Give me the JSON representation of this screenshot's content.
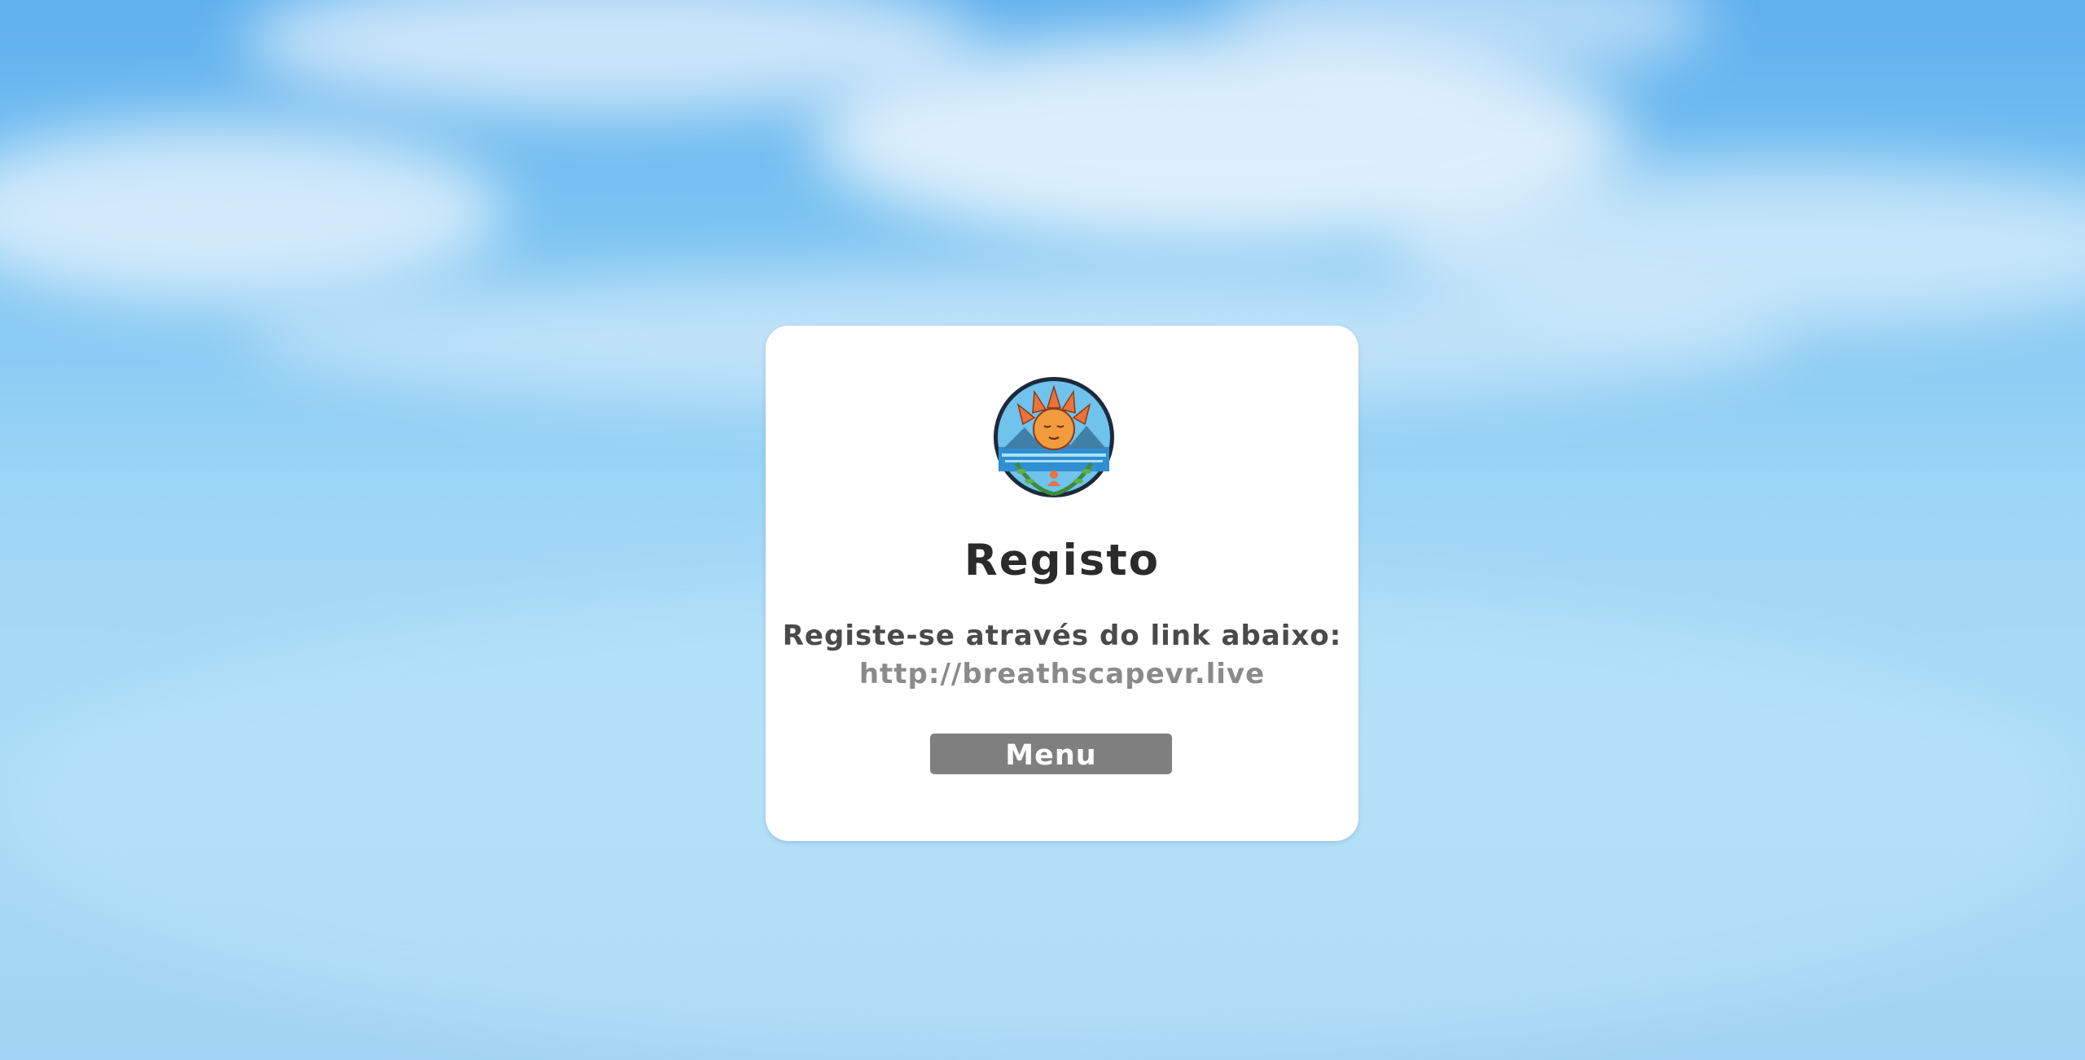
{
  "dialog": {
    "logo_icon": "breathscape-sun-lotus-logo-icon",
    "title": "Registo",
    "instruction": "Registe-se através do link abaixo:",
    "link": "http://breathscapevr.live",
    "menu_button_label": "Menu"
  },
  "colors": {
    "sky_top": "#5fb0ee",
    "sky_bottom": "#a3d3f4",
    "panel": "#ffffff",
    "title_text": "#2b2b2b",
    "instruction_text": "#4a4a4a",
    "link_text": "#8a8a8a",
    "button_bg": "#7f7f7f",
    "button_text": "#ffffff"
  }
}
